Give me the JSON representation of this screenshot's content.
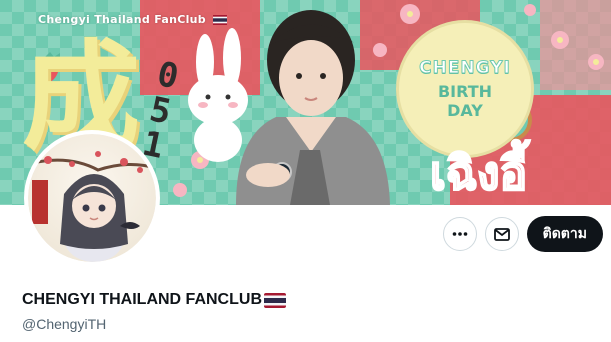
{
  "banner": {
    "club_label": "Chengyi Thailand FanClub",
    "big_character": "成",
    "date_digits": [
      "0",
      "5",
      "1"
    ],
    "birthday_lines": [
      "CHENGYI",
      "BIRTH",
      "DAY"
    ],
    "thai_name": "เฉิงอี้",
    "colors": {
      "background": "#6fcab0",
      "accent_red": "#e9555e",
      "cream": "#f5efb8"
    }
  },
  "profile": {
    "display_name": "CHENGYI THAILAND FANCLUB",
    "handle": "@ChengyiTH",
    "flag_icon": "thailand-flag"
  },
  "actions": {
    "more_icon": "more-horizontal-icon",
    "message_icon": "envelope-icon",
    "follow_label": "ติดตาม"
  }
}
